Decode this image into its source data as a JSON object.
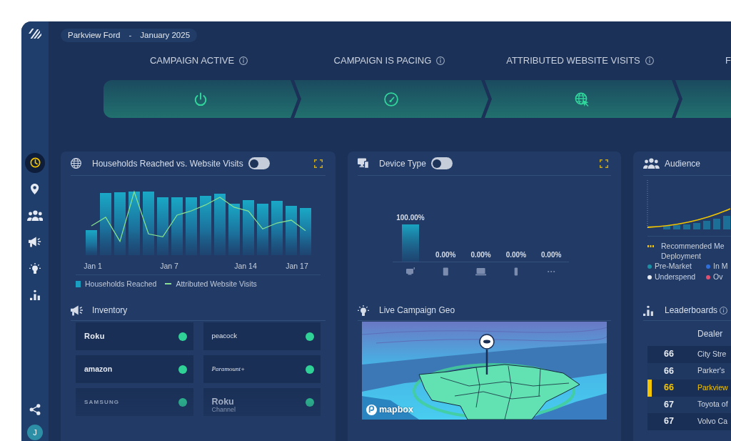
{
  "sidebar": {
    "items": [
      {
        "selected": true
      },
      {
        "selected": false
      },
      {
        "selected": false
      },
      {
        "selected": false
      },
      {
        "selected": false
      },
      {
        "selected": false
      }
    ],
    "user_initial": "J"
  },
  "header": {
    "dealer": "Parkview Ford",
    "separator": "-",
    "period": "January 2025"
  },
  "steps": [
    {
      "label": "CAMPAIGN ACTIVE",
      "info": true
    },
    {
      "label": "CAMPAIGN IS PACING",
      "info": true
    },
    {
      "label": "ATTRIBUTED WEBSITE VISITS",
      "info": true
    },
    {
      "label": "F",
      "info": false
    }
  ],
  "households_panel": {
    "title": "Households Reached vs. Website Visits",
    "toggle": {
      "on": false
    },
    "x_labels": [
      "Jan 1",
      "Jan 7",
      "Jan 14",
      "Jan 17"
    ],
    "legend": [
      {
        "label": "Households Reached",
        "kind": "bar",
        "color": "#1a9fc0"
      },
      {
        "label": "Attributed Website Visits",
        "kind": "line",
        "color": "#86e08f"
      }
    ]
  },
  "device_panel": {
    "title": "Device Type",
    "toggle": {
      "on": false
    },
    "bar_labels": [
      "100.00%",
      "0.00%",
      "0.00%",
      "0.00%",
      "0.00%"
    ]
  },
  "audience_panel": {
    "title": "Audience",
    "legend": [
      {
        "label": "Recommended Me Deployment",
        "kind": "line",
        "color": "#f2c500"
      },
      {
        "label": "Pre-Market",
        "kind": "dot",
        "color": "#1b8fa3"
      },
      {
        "label": "In M",
        "kind": "dot",
        "color": "#2f6fdc"
      },
      {
        "label": "Underspend",
        "kind": "dot",
        "color": "#e6e9ef"
      },
      {
        "label": "Ov",
        "kind": "dot",
        "color": "#e0506e"
      }
    ]
  },
  "inventory_panel": {
    "title": "Inventory",
    "items": [
      {
        "logo": "Roku"
      },
      {
        "logo": "peacock"
      },
      {
        "logo": "amazon"
      },
      {
        "logo": "Paramount+"
      },
      {
        "logo": "SAMSUNG"
      },
      {
        "logo": "Roku",
        "sub": "Channel"
      }
    ]
  },
  "geo_panel": {
    "title": "Live Campaign Geo",
    "attribution": "mapbox"
  },
  "leaderboard_panel": {
    "title": "Leaderboards",
    "dealer_header": "Dealer",
    "rows": [
      {
        "column_1": "66",
        "dealer": "City Stre",
        "selected": false
      },
      {
        "column_1": "66",
        "dealer": "Parker's",
        "selected": false
      },
      {
        "column_1": "66",
        "dealer": "Parkview",
        "selected": true
      },
      {
        "column_1": "67",
        "dealer": "Toyota of",
        "selected": false
      },
      {
        "column_1": "67",
        "dealer": "Volvo Ca",
        "selected": false
      }
    ]
  }
}
